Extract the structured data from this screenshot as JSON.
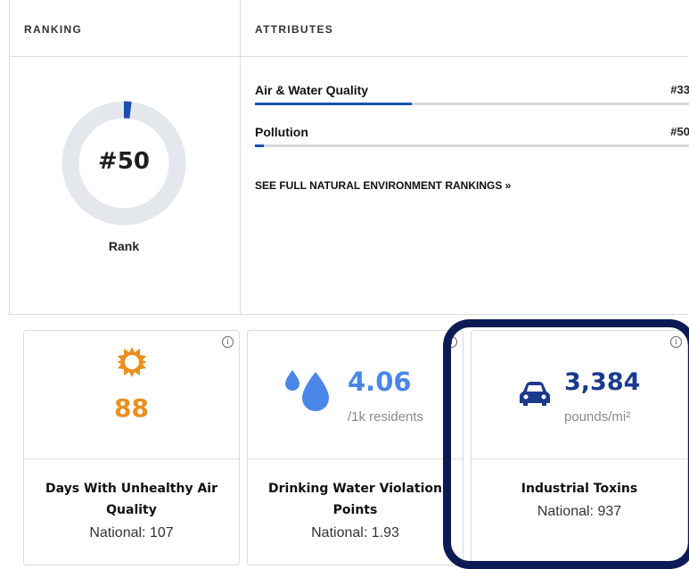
{
  "headers": {
    "ranking": "RANKING",
    "attributes": "ATTRIBUTES"
  },
  "rank": {
    "value": "#50",
    "label": "Rank",
    "ring_fill_fraction": 0.02,
    "color": "#1a4fb0",
    "track_color": "#e4e7ec"
  },
  "attributes": [
    {
      "name": "Air & Water Quality",
      "rank": "#33",
      "bar_fraction": 0.36
    },
    {
      "name": "Pollution",
      "rank": "#50",
      "bar_fraction": 0.02
    }
  ],
  "see_full_link": "SEE FULL NATURAL ENVIRONMENT RANKINGS »",
  "stats": [
    {
      "icon": "sun-icon",
      "value": "88",
      "unit": "",
      "title_line1": "Days With Unhealthy Air",
      "title_line2": "Quality",
      "national": "National: 107",
      "color": "#e8901e"
    },
    {
      "icon": "water-drops-icon",
      "value": "4.06",
      "unit": "/1k residents",
      "title_line1": "Drinking Water Violation",
      "title_line2": "Points",
      "national": "National: 1.93",
      "color": "#4a86e8"
    },
    {
      "icon": "car-icon",
      "value": "3,384",
      "unit": "pounds/mi²",
      "title_line1": "Industrial Toxins",
      "title_line2": "",
      "national": "National: 937",
      "color": "#1a3a8c"
    }
  ],
  "info_glyph": "i",
  "highlight_color": "#0d1a55"
}
